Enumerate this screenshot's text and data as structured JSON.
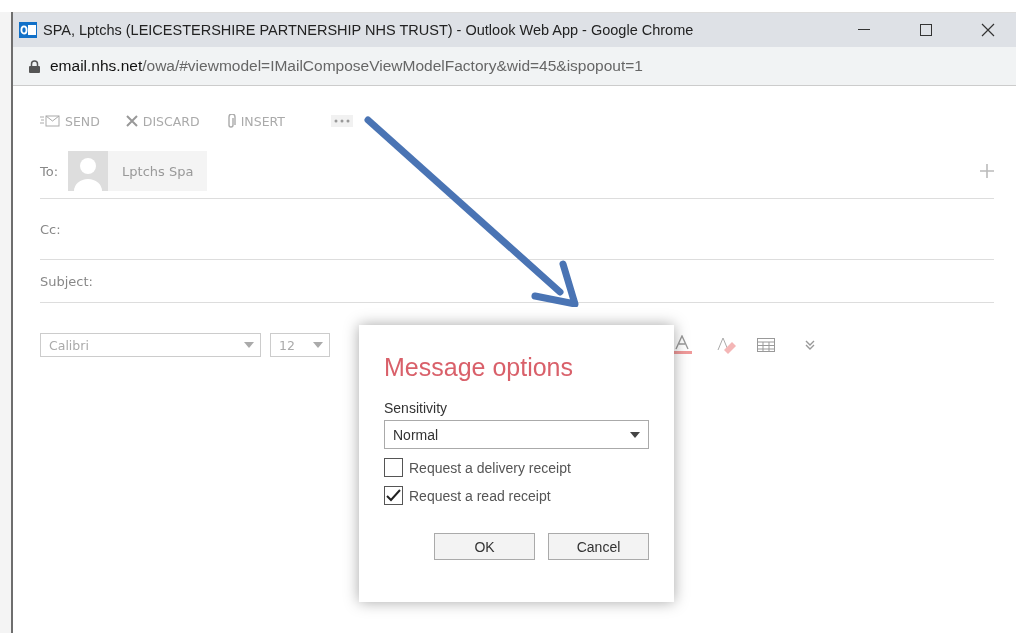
{
  "window": {
    "title": "SPA, Lptchs (LEICESTERSHIRE PARTNERSHIP NHS TRUST) - Outlook Web App - Google Chrome"
  },
  "address_bar": {
    "host": "email.nhs.net",
    "path": "/owa/#viewmodel=IMailComposeViewModelFactory&wid=45&ispopout=1"
  },
  "toolbar": [
    {
      "kind": "send",
      "label": "SEND"
    },
    {
      "kind": "discard",
      "label": "DISCARD"
    },
    {
      "kind": "insert",
      "label": "INSERT"
    },
    {
      "kind": "more"
    }
  ],
  "to": {
    "label": "To:",
    "recipient": "Lptchs Spa"
  },
  "cc": {
    "label": "Cc:"
  },
  "subject": {
    "label": "Subject:"
  },
  "format_bar": {
    "font": "Calibri",
    "size": "12"
  },
  "dialog": {
    "title": "Message options",
    "sensitivity_label": "Sensitivity",
    "sensitivity": "Normal",
    "options": [
      {
        "label": "Request a delivery receipt",
        "checked": false
      },
      {
        "label": "Request a read receipt",
        "checked": true
      }
    ],
    "buttons": [
      "OK",
      "Cancel"
    ]
  }
}
